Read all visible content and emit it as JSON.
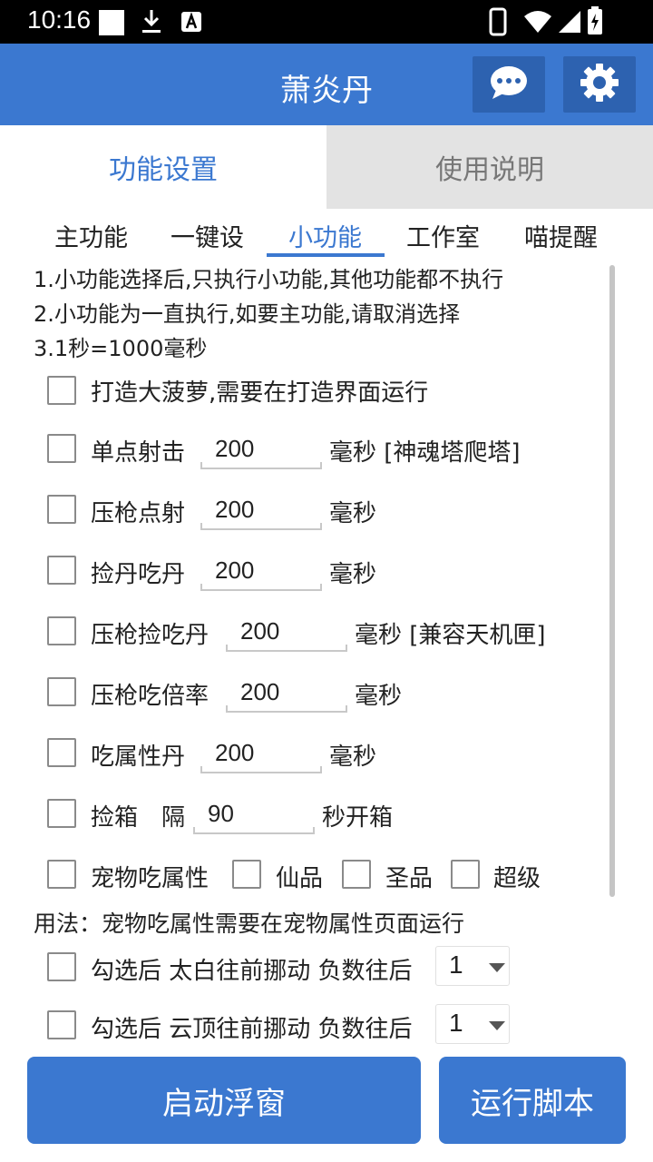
{
  "status_bar": {
    "time": "10:16"
  },
  "app": {
    "title": "萧炎丹"
  },
  "top_tabs": [
    {
      "label": "功能设置"
    },
    {
      "label": "使用说明"
    }
  ],
  "sub_tabs": [
    {
      "label": "主功能"
    },
    {
      "label": "一键设"
    },
    {
      "label": "小功能"
    },
    {
      "label": "工作室"
    },
    {
      "label": "喵提醒"
    }
  ],
  "notes": [
    "1.小功能选择后,只执行小功能,其他功能都不执行",
    "2.小功能为一直执行,如要主功能,请取消选择",
    "3.1秒=1000毫秒"
  ],
  "options": {
    "forge": {
      "label": "打造大菠萝,需要在打造界面运行"
    },
    "single_shot": {
      "label": "单点射击",
      "value": "200",
      "unit": "毫秒 [神魂塔爬塔]"
    },
    "press_shot": {
      "label": "压枪点射",
      "value": "200",
      "unit": "毫秒"
    },
    "pick_eat": {
      "label": "捡丹吃丹",
      "value": "200",
      "unit": "毫秒"
    },
    "press_pick_eat": {
      "label": "压枪捡吃丹",
      "value": "200",
      "unit": "毫秒 [兼容天机匣]"
    },
    "press_eat_rate": {
      "label": "压枪吃倍率",
      "value": "200",
      "unit": "毫秒"
    },
    "eat_attr": {
      "label": "吃属性丹",
      "value": "200",
      "unit": "毫秒"
    },
    "pick_box": {
      "label": "捡箱",
      "mid": "隔",
      "value": "90",
      "unit": "秒开箱"
    },
    "pet": {
      "label": "宠物吃属性",
      "grades": [
        "仙品",
        "圣品",
        "超级"
      ]
    }
  },
  "usage": "用法：宠物吃属性需要在宠物属性页面运行",
  "moves": [
    {
      "label": "勾选后 太白往前挪动 负数往后",
      "value": "1"
    },
    {
      "label": "勾选后 云顶往前挪动 负数往后",
      "value": "1"
    }
  ],
  "buttons": {
    "float": "启动浮窗",
    "run": "运行脚本"
  },
  "colors": {
    "primary": "#3b78d0",
    "primary_dark": "#2d62b0",
    "tab_inactive_bg": "#e3e3e3"
  }
}
